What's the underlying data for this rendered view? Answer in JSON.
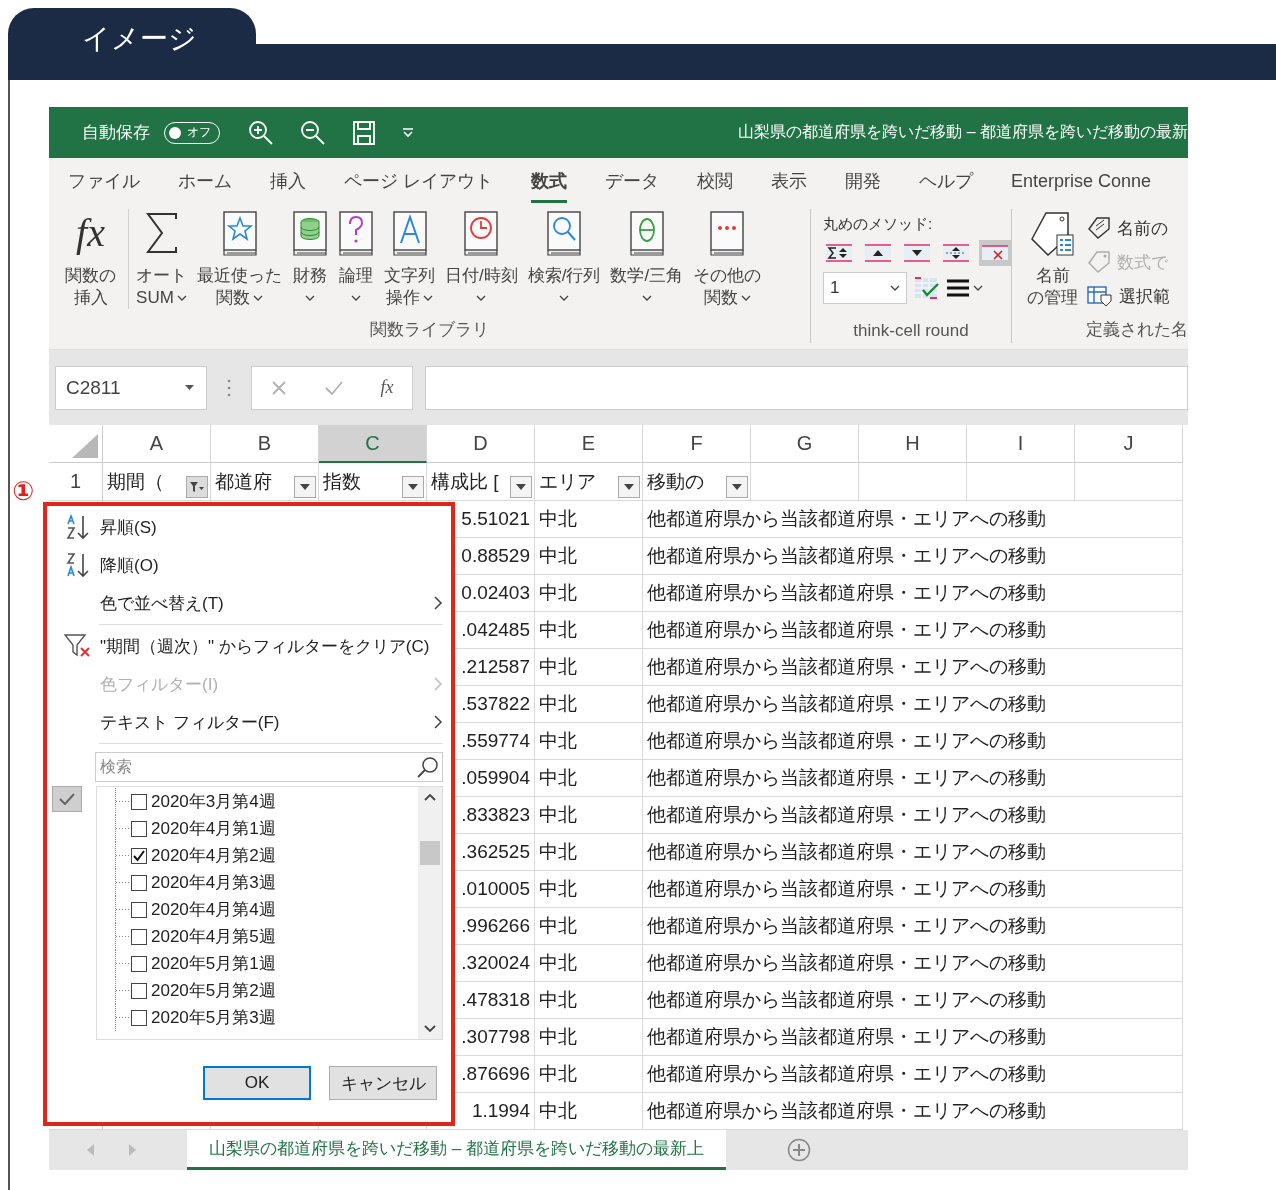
{
  "heading": {
    "title": "イメージ"
  },
  "excel": {
    "title_bar": {
      "autosave_label": "自動保存",
      "autosave_on": false,
      "autosave_state": "オフ",
      "document_title": "山梨県の都道府県を跨いだ移動 – 都道府県を跨いだ移動の最新"
    },
    "ribbon_tabs": [
      {
        "label": "ファイル",
        "selected": false
      },
      {
        "label": "ホーム",
        "selected": false
      },
      {
        "label": "挿入",
        "selected": false
      },
      {
        "label": "ページ レイアウト",
        "selected": false
      },
      {
        "label": "数式",
        "selected": true
      },
      {
        "label": "データ",
        "selected": false
      },
      {
        "label": "校閲",
        "selected": false
      },
      {
        "label": "表示",
        "selected": false
      },
      {
        "label": "開発",
        "selected": false
      },
      {
        "label": "ヘルプ",
        "selected": false
      },
      {
        "label": "Enterprise Conne",
        "selected": false
      }
    ],
    "function_library": {
      "label": "関数ライブラリ",
      "buttons": [
        {
          "kind": "insert-function",
          "symbol": "fx",
          "lines": [
            "関数の",
            "挿入"
          ],
          "dropdown": false
        },
        {
          "kind": "sum",
          "lines": [
            "オート",
            "SUM"
          ],
          "dropdown": true
        },
        {
          "kind": "star",
          "lines": [
            "最近使った",
            "関数"
          ],
          "dropdown": true
        },
        {
          "kind": "database",
          "lines": [
            "財務"
          ],
          "dropdown": true
        },
        {
          "kind": "question",
          "lines": [
            "論理"
          ],
          "dropdown": true
        },
        {
          "kind": "letter",
          "lines": [
            "文字列",
            "操作"
          ],
          "dropdown": true
        },
        {
          "kind": "clock",
          "lines": [
            "日付/時刻"
          ],
          "dropdown": true
        },
        {
          "kind": "magnifier",
          "lines": [
            "検索/行列"
          ],
          "dropdown": true
        },
        {
          "kind": "theta",
          "lines": [
            "数学/三角"
          ],
          "dropdown": true
        },
        {
          "kind": "dots",
          "lines": [
            "その他の",
            "関数"
          ],
          "dropdown": true
        }
      ]
    },
    "think_cell": {
      "label": "think-cell round",
      "method_label": "丸めのメソッド:",
      "round_buttons": [
        {
          "kind": "sum-both",
          "selected": false
        },
        {
          "kind": "up",
          "selected": false
        },
        {
          "kind": "down",
          "selected": false
        },
        {
          "kind": "both",
          "selected": false
        },
        {
          "kind": "clear",
          "selected": true
        }
      ],
      "precision_value": "1"
    },
    "defined_names": {
      "label": "定義された名",
      "manage_lines": [
        "名前",
        "の管理"
      ],
      "items": [
        {
          "kind": "tag",
          "label": "名前の",
          "disabled": false
        },
        {
          "kind": "formula-tag",
          "label": "数式で",
          "disabled": true
        },
        {
          "kind": "selection",
          "label": "選択範",
          "disabled": false
        }
      ]
    },
    "formula_bar": {
      "name_box": "C2811",
      "function_symbol": "fx"
    },
    "sheet": {
      "columns": [
        {
          "letter": "A",
          "selected": false
        },
        {
          "letter": "B",
          "selected": false
        },
        {
          "letter": "C",
          "selected": true
        },
        {
          "letter": "D",
          "selected": false
        },
        {
          "letter": "E",
          "selected": false
        },
        {
          "letter": "F",
          "selected": false
        },
        {
          "letter": "G",
          "selected": false
        },
        {
          "letter": "H",
          "selected": false
        },
        {
          "letter": "I",
          "selected": false
        },
        {
          "letter": "J",
          "selected": false
        }
      ],
      "header_row": {
        "number": "1",
        "cells": [
          {
            "text": "期間（",
            "filter_active": true
          },
          {
            "text": "都道府",
            "filter_active": false
          },
          {
            "text": "指数",
            "filter_active": false
          },
          {
            "text": "構成比 [",
            "filter_active": false
          },
          {
            "text": "エリア",
            "filter_active": false
          },
          {
            "text": "移動の",
            "filter_active": false
          }
        ]
      },
      "rows": [
        {
          "column_d": "5.51021",
          "column_e": "中北",
          "column_f": "他都道府県から当該都道府県・エリアへの移動"
        },
        {
          "column_d": "0.88529",
          "column_e": "中北",
          "column_f": "他都道府県から当該都道府県・エリアへの移動"
        },
        {
          "column_d": "0.02403",
          "column_e": "中北",
          "column_f": "他都道府県から当該都道府県・エリアへの移動"
        },
        {
          "column_d": ".042485",
          "column_e": "中北",
          "column_f": "他都道府県から当該都道府県・エリアへの移動"
        },
        {
          "column_d": ".212587",
          "column_e": "中北",
          "column_f": "他都道府県から当該都道府県・エリアへの移動"
        },
        {
          "column_d": ".537822",
          "column_e": "中北",
          "column_f": "他都道府県から当該都道府県・エリアへの移動"
        },
        {
          "column_d": ".559774",
          "column_e": "中北",
          "column_f": "他都道府県から当該都道府県・エリアへの移動"
        },
        {
          "column_d": ".059904",
          "column_e": "中北",
          "column_f": "他都道府県から当該都道府県・エリアへの移動"
        },
        {
          "column_d": ".833823",
          "column_e": "中北",
          "column_f": "他都道府県から当該都道府県・エリアへの移動"
        },
        {
          "column_d": ".362525",
          "column_e": "中北",
          "column_f": "他都道府県から当該都道府県・エリアへの移動"
        },
        {
          "column_d": ".010005",
          "column_e": "中北",
          "column_f": "他都道府県から当該都道府県・エリアへの移動"
        },
        {
          "column_d": ".996266",
          "column_e": "中北",
          "column_f": "他都道府県から当該都道府県・エリアへの移動"
        },
        {
          "column_d": ".320024",
          "column_e": "中北",
          "column_f": "他都道府県から当該都道府県・エリアへの移動"
        },
        {
          "column_d": ".478318",
          "column_e": "中北",
          "column_f": "他都道府県から当該都道府県・エリアへの移動"
        },
        {
          "column_d": ".307798",
          "column_e": "中北",
          "column_f": "他都道府県から当該都道府県・エリアへの移動"
        },
        {
          "column_d": ".876696",
          "column_e": "中北",
          "column_f": "他都道府県から当該都道府県・エリアへの移動"
        },
        {
          "column_d": "1.1994",
          "column_e": "中北",
          "column_f": "他都道府県から当該都道府県・エリアへの移動"
        }
      ]
    },
    "filter_popup": {
      "menu": [
        {
          "kind": "sort-ascending",
          "label": "昇順(S)",
          "disabled": false
        },
        {
          "kind": "sort-descending",
          "label": "降順(O)",
          "disabled": false
        },
        {
          "kind": "submenu",
          "label": "色で並べ替え(T)",
          "disabled": false
        },
        {
          "kind": "divider"
        },
        {
          "kind": "clear-filter",
          "label": "\"期間（週次）\" からフィルターをクリア(C)",
          "disabled": false
        },
        {
          "kind": "submenu",
          "label": "色フィルター(I)",
          "disabled": true
        },
        {
          "kind": "submenu",
          "label": "テキスト フィルター(F)",
          "disabled": false
        },
        {
          "kind": "divider"
        }
      ],
      "search": {
        "placeholder": "検索"
      },
      "list": [
        {
          "label": "2020年3月第4週",
          "checked": false
        },
        {
          "label": "2020年4月第1週",
          "checked": false
        },
        {
          "label": "2020年4月第2週",
          "checked": true
        },
        {
          "label": "2020年4月第3週",
          "checked": false
        },
        {
          "label": "2020年4月第4週",
          "checked": false
        },
        {
          "label": "2020年4月第5週",
          "checked": false
        },
        {
          "label": "2020年5月第1週",
          "checked": false
        },
        {
          "label": "2020年5月第2週",
          "checked": false
        },
        {
          "label": "2020年5月第3週",
          "checked": false
        }
      ],
      "buttons": [
        {
          "label": "OK",
          "kind": "default"
        },
        {
          "label": "キャンセル",
          "kind": "normal"
        }
      ]
    },
    "sheet_tabs": [
      {
        "label": "山梨県の都道府県を跨いだ移動 – 都道府県を跨いだ移動の最新上",
        "selected": true
      }
    ]
  },
  "annotation": {
    "marker": "①"
  }
}
